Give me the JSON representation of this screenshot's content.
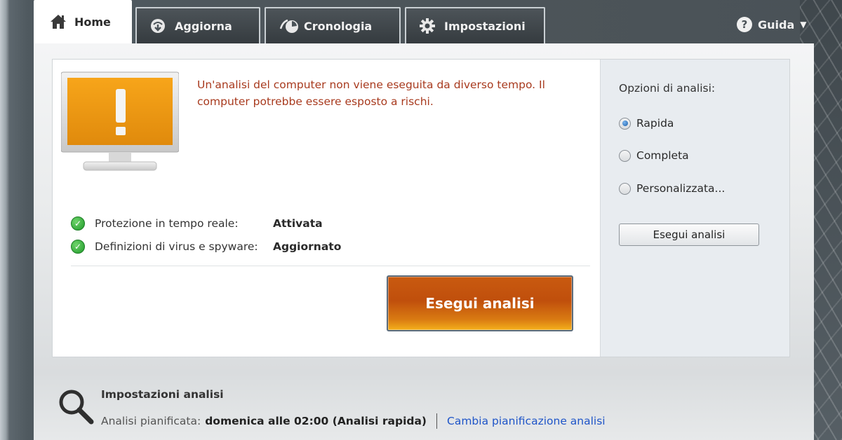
{
  "tabs": [
    {
      "label": "Home",
      "icon": "home-icon"
    },
    {
      "label": "Aggiorna",
      "icon": "update-icon"
    },
    {
      "label": "Cronologia",
      "icon": "history-icon"
    },
    {
      "label": "Impostazioni",
      "icon": "gear-icon"
    }
  ],
  "help": {
    "label": "Guida",
    "icon": "help-icon"
  },
  "alert": {
    "message": "Un'analisi del computer non viene eseguita da diverso tempo. Il computer potrebbe essere esposto a rischi."
  },
  "status": [
    {
      "label": "Protezione in tempo reale:",
      "value": "Attivata"
    },
    {
      "label": "Definizioni di virus e spyware:",
      "value": "Aggiornato"
    }
  ],
  "scan_button": "Esegui analisi",
  "options": {
    "title": "Opzioni di analisi:",
    "items": [
      {
        "label": "Rapida",
        "selected": true
      },
      {
        "label": "Completa",
        "selected": false
      },
      {
        "label": "Personalizzata...",
        "selected": false
      }
    ],
    "button": "Esegui analisi"
  },
  "schedule": {
    "title": "Impostazioni analisi",
    "label": "Analisi pianificata:",
    "value": "domenica alle 02:00 (Analisi rapida)",
    "link": "Cambia pianificazione analisi"
  },
  "colors": {
    "accent_orange": "#c95a10",
    "alert_text": "#a83a1e",
    "link": "#1f55c8",
    "ok_green": "#1f9a2a"
  }
}
